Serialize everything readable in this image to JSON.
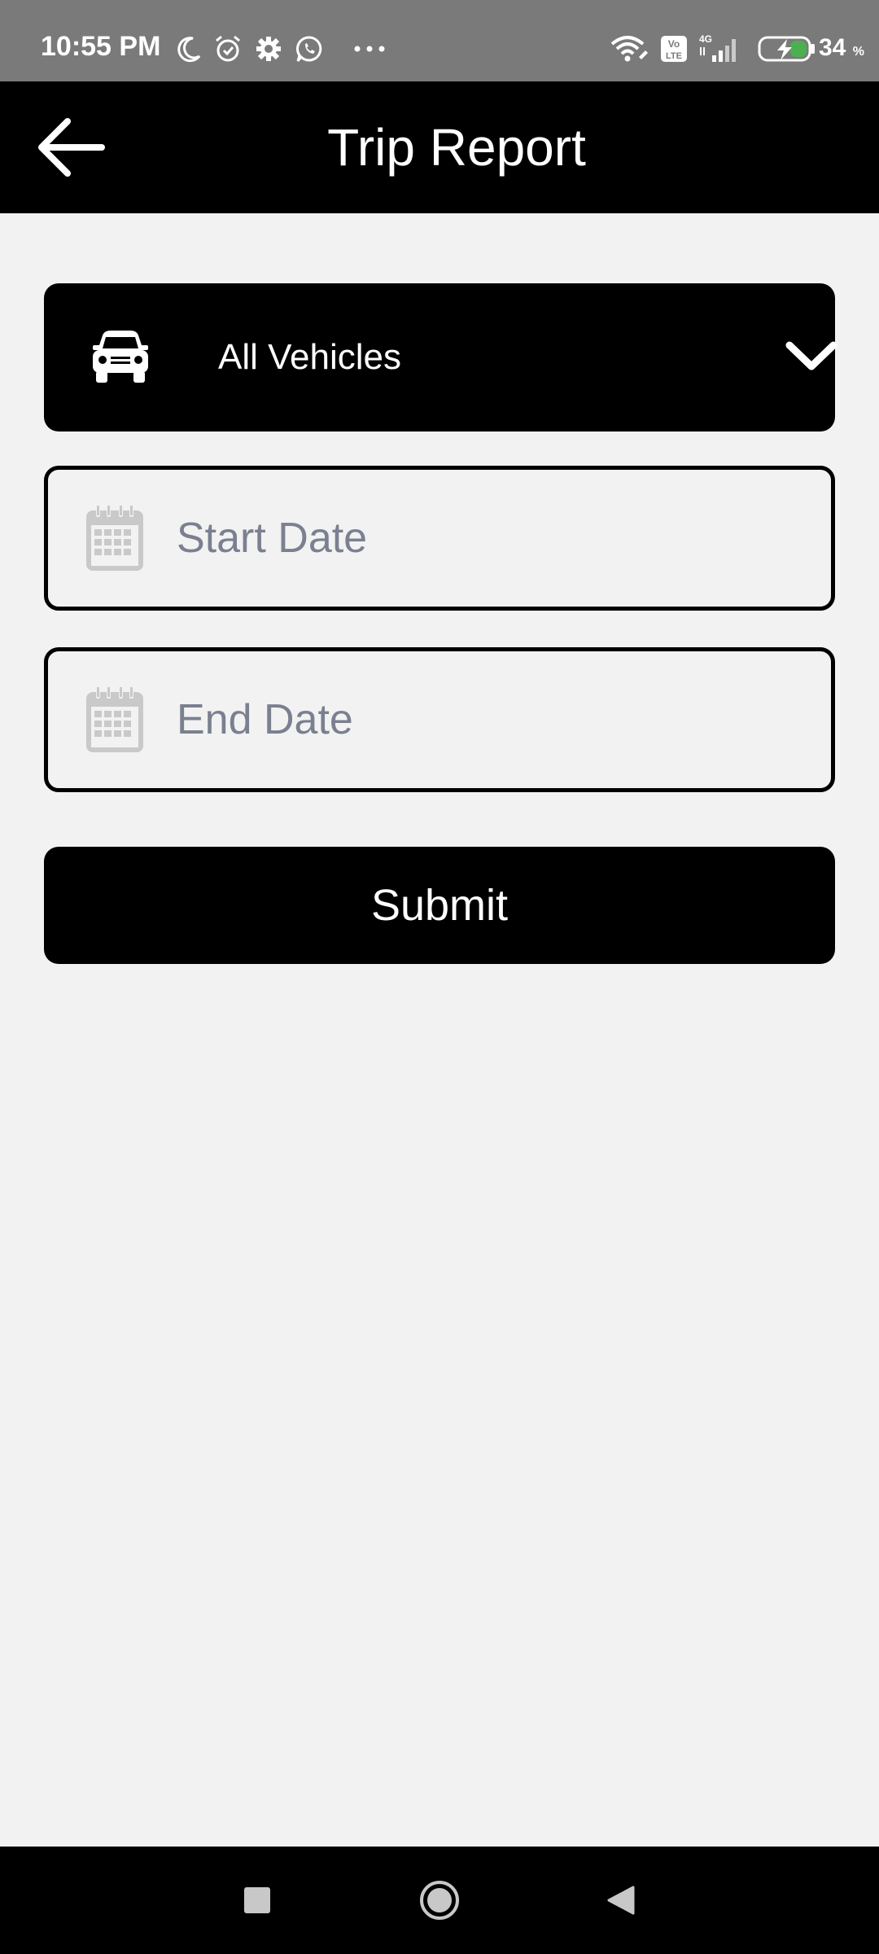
{
  "status_bar": {
    "time": "10:55 PM",
    "battery_percent": "34",
    "battery_unit": "%",
    "left_icons": [
      "moon-icon",
      "alarm-icon",
      "settings-icon",
      "whatsapp-icon",
      "more-icon"
    ],
    "right_icons": [
      "wifi-icon",
      "volte-icon",
      "signal-icon",
      "battery-charging-icon"
    ]
  },
  "app_bar": {
    "title": "Trip Report"
  },
  "form": {
    "vehicle_select": {
      "label": "All Vehicles"
    },
    "start_date": {
      "placeholder": "Start Date"
    },
    "end_date": {
      "placeholder": "End Date"
    },
    "submit_label": "Submit"
  },
  "nav_bar": {
    "buttons": [
      "recents",
      "home",
      "back"
    ]
  },
  "colors": {
    "primary": "#000000",
    "background": "#f2f2f2",
    "status_bar": "#7a7a7a",
    "placeholder": "#7a8090",
    "calendar_icon": "#c9c9c9"
  }
}
